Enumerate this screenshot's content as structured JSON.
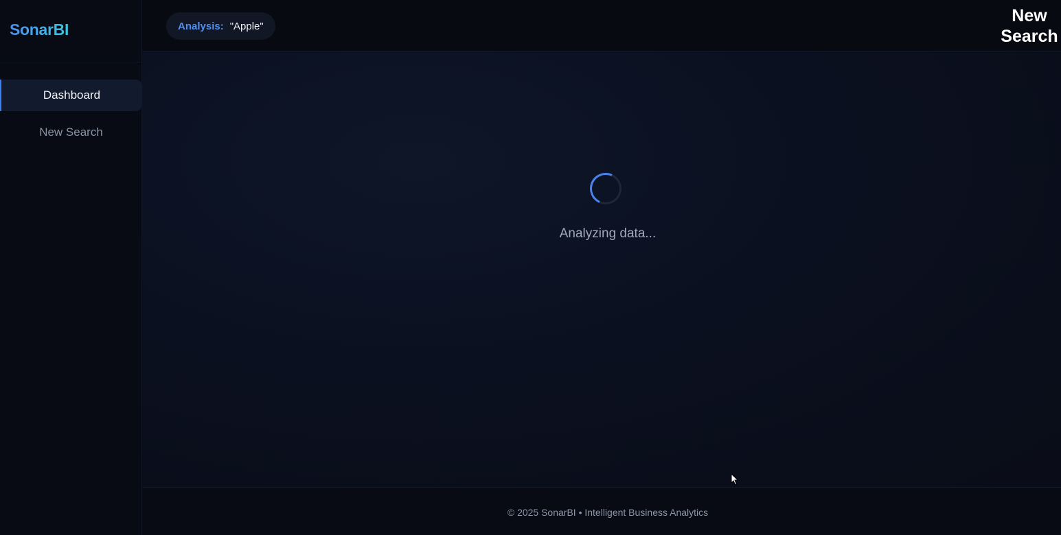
{
  "app": {
    "brand": "SonarBI"
  },
  "sidebar": {
    "items": [
      {
        "label": "Dashboard",
        "active": true
      },
      {
        "label": "New Search",
        "active": false
      }
    ]
  },
  "header": {
    "analysis_label": "Analysis:",
    "analysis_value": "\"Apple\"",
    "new_search_label_line1": "New",
    "new_search_label_line2": "Search"
  },
  "main": {
    "loading_text": "Analyzing data..."
  },
  "footer": {
    "text": "© 2025 SonarBI • Intelligent Business Analytics"
  },
  "colors": {
    "accent": "#3b82f6",
    "brand_gradient_start": "#4f8ff0",
    "brand_gradient_end": "#38c6e0",
    "background": "#0a0d16"
  },
  "icons": {
    "spinner": "loading-spinner-icon",
    "cursor": "mouse-pointer-icon"
  }
}
